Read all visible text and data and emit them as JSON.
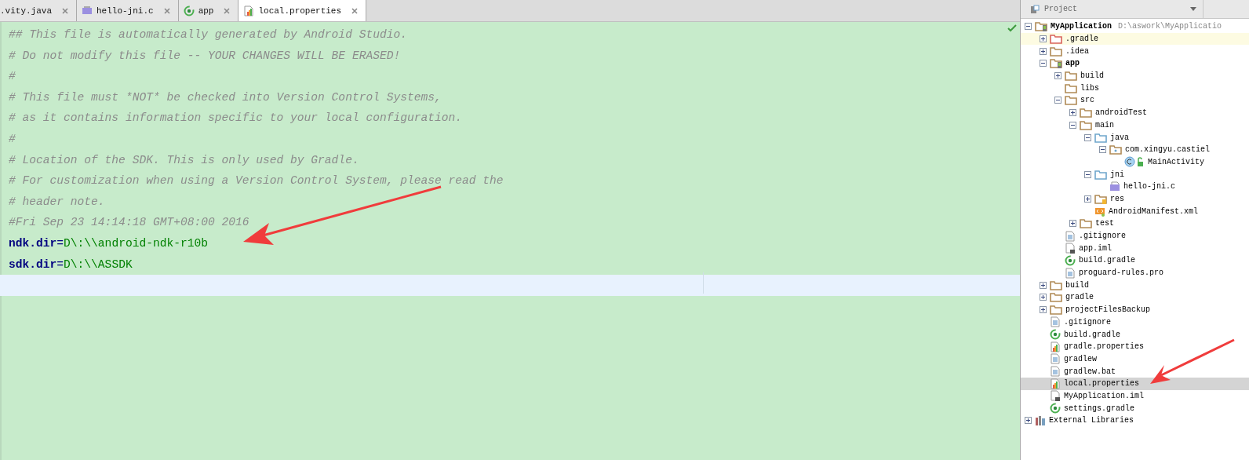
{
  "tabs": [
    {
      "label": ".vity.java",
      "kind": "plain",
      "selected": false
    },
    {
      "label": "hello-jni.c",
      "kind": "cpp",
      "selected": false
    },
    {
      "label": "app",
      "kind": "gradle",
      "selected": false
    },
    {
      "label": "local.properties",
      "kind": "props",
      "selected": true
    }
  ],
  "editor": {
    "lines": [
      {
        "kind": "comment",
        "text": "## This file is automatically generated by Android Studio."
      },
      {
        "kind": "comment",
        "text": "# Do not modify this file -- YOUR CHANGES WILL BE ERASED!"
      },
      {
        "kind": "comment",
        "text": "#"
      },
      {
        "kind": "comment",
        "text": "# This file must *NOT* be checked into Version Control Systems,"
      },
      {
        "kind": "comment",
        "text": "# as it contains information specific to your local configuration."
      },
      {
        "kind": "comment",
        "text": "#"
      },
      {
        "kind": "comment",
        "text": "# Location of the SDK. This is only used by Gradle."
      },
      {
        "kind": "comment",
        "text": "# For customization when using a Version Control System, please read the"
      },
      {
        "kind": "comment",
        "text": "# header note."
      },
      {
        "kind": "comment",
        "text": "#Fri Sep 23 14:14:18 GMT+08:00 2016"
      },
      {
        "kind": "property",
        "key": "ndk.dir",
        "sep": "=",
        "value": "D\\:\\\\android-ndk-r10b"
      },
      {
        "kind": "property",
        "key": "sdk.dir",
        "sep": "=",
        "value": "D\\:\\\\ASSDK"
      },
      {
        "kind": "current"
      }
    ]
  },
  "project": {
    "title": "Project",
    "tree": [
      {
        "name": "MyApplication",
        "path": "D:\\aswork\\MyApplicatio",
        "kind": "module",
        "bold": true,
        "expanded": true,
        "children": [
          {
            "name": ".gradle",
            "kind": "folder-red",
            "expanded": false,
            "highlighted": true
          },
          {
            "name": ".idea",
            "kind": "folder",
            "expanded": false
          },
          {
            "name": "app",
            "kind": "module",
            "bold": true,
            "expanded": true,
            "children": [
              {
                "name": "build",
                "kind": "folder",
                "expanded": false
              },
              {
                "name": "libs",
                "kind": "folder"
              },
              {
                "name": "src",
                "kind": "folder",
                "expanded": true,
                "children": [
                  {
                    "name": "androidTest",
                    "kind": "folder",
                    "expanded": false
                  },
                  {
                    "name": "main",
                    "kind": "folder",
                    "expanded": true,
                    "children": [
                      {
                        "name": "java",
                        "kind": "folder-blue",
                        "expanded": true,
                        "children": [
                          {
                            "name": "com.xingyu.castiel",
                            "kind": "package",
                            "expanded": true,
                            "children": [
                              {
                                "name": "MainActivity",
                                "kind": "class"
                              }
                            ]
                          }
                        ]
                      },
                      {
                        "name": "jni",
                        "kind": "folder-blue",
                        "expanded": true,
                        "children": [
                          {
                            "name": "hello-jni.c",
                            "kind": "cpp"
                          }
                        ]
                      },
                      {
                        "name": "res",
                        "kind": "folder-res",
                        "expanded": false
                      },
                      {
                        "name": "AndroidManifest.xml",
                        "kind": "manifest"
                      }
                    ]
                  },
                  {
                    "name": "test",
                    "kind": "folder",
                    "expanded": false
                  }
                ]
              },
              {
                "name": ".gitignore",
                "kind": "text"
              },
              {
                "name": "app.iml",
                "kind": "iml"
              },
              {
                "name": "build.gradle",
                "kind": "gradle"
              },
              {
                "name": "proguard-rules.pro",
                "kind": "text"
              }
            ]
          },
          {
            "name": "build",
            "kind": "folder",
            "expanded": false
          },
          {
            "name": "gradle",
            "kind": "folder",
            "expanded": false
          },
          {
            "name": "projectFilesBackup",
            "kind": "folder",
            "expanded": false
          },
          {
            "name": ".gitignore",
            "kind": "text"
          },
          {
            "name": "build.gradle",
            "kind": "gradle"
          },
          {
            "name": "gradle.properties",
            "kind": "props"
          },
          {
            "name": "gradlew",
            "kind": "text"
          },
          {
            "name": "gradlew.bat",
            "kind": "text"
          },
          {
            "name": "local.properties",
            "kind": "props",
            "selected": true
          },
          {
            "name": "MyApplication.iml",
            "kind": "iml"
          },
          {
            "name": "settings.gradle",
            "kind": "gradle"
          }
        ]
      },
      {
        "name": "External Libraries",
        "kind": "libraries",
        "expanded": false
      }
    ]
  }
}
